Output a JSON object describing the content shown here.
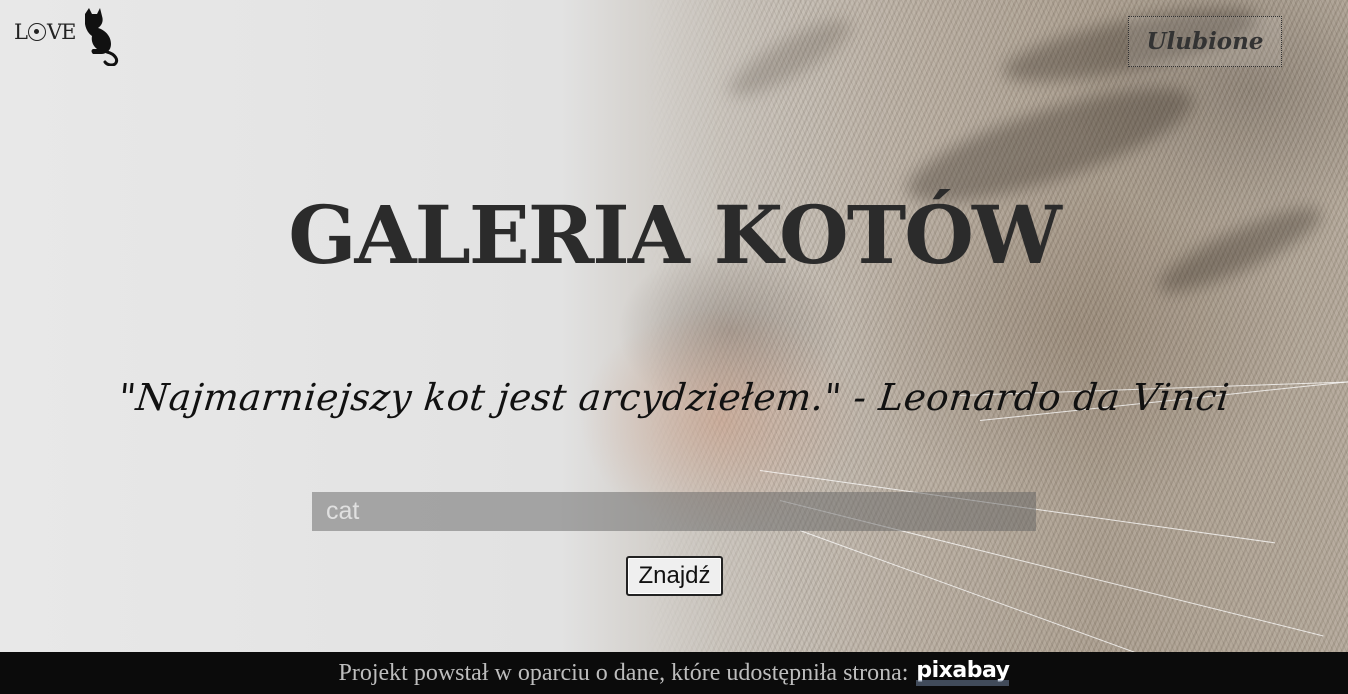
{
  "logo": {
    "text_before": "L",
    "text_after": "VE",
    "icon": "cat-silhouette-icon"
  },
  "header": {
    "favorites_label": "Ulubione"
  },
  "hero": {
    "title": "GALERIA KOTÓW",
    "quote": "\"Najmarniejszy kot jest arcydziełem.\" - Leonardo da Vinci"
  },
  "search": {
    "placeholder": "cat",
    "value": "",
    "button_label": "Znajdź"
  },
  "footer": {
    "text": "Projekt powstał w oparciu o dane, które udostępniła strona:",
    "link_label": "pixabay"
  },
  "colors": {
    "title": "#2b2b2b",
    "footer_bg": "#0b0b0b",
    "footer_text": "#bdbdbd"
  }
}
